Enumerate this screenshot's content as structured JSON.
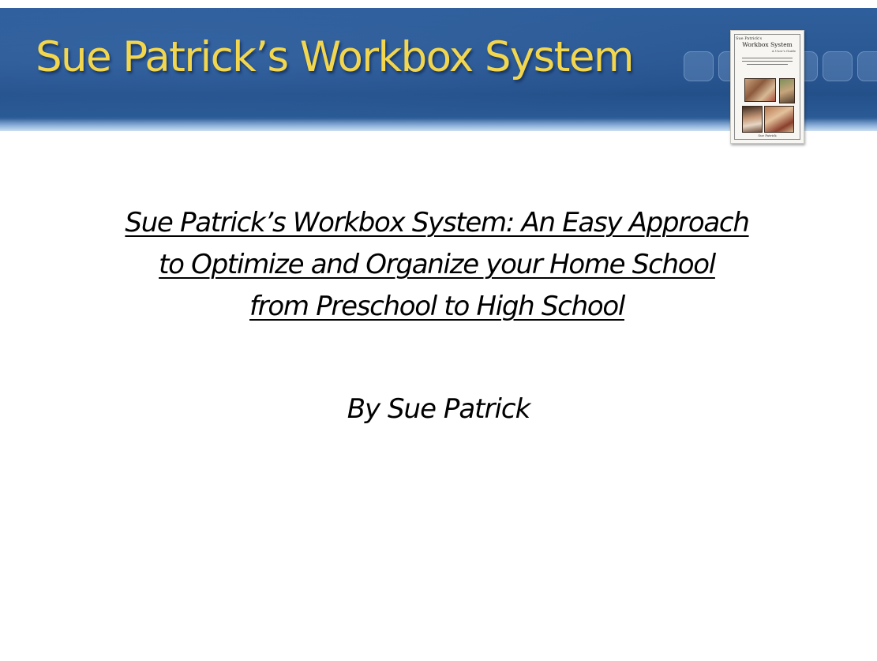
{
  "slide": {
    "header": {
      "title": "Sue Patrick’s Workbox System"
    },
    "book_cover": {
      "author_top": "Sue Patrick's",
      "title": "Workbox System",
      "subtitle": "A User's Guide",
      "author_bottom": "Sue Patrick"
    },
    "body": {
      "subtitle_lines": [
        "Sue Patrick’s Workbox System: An Easy Approach",
        "to Optimize and Organize your Home School",
        "from Preschool to High School"
      ],
      "byline": "By Sue Patrick"
    },
    "colors": {
      "banner_blue": "#2a5792",
      "title_gold": "#f2d64e",
      "text": "#000000"
    }
  }
}
